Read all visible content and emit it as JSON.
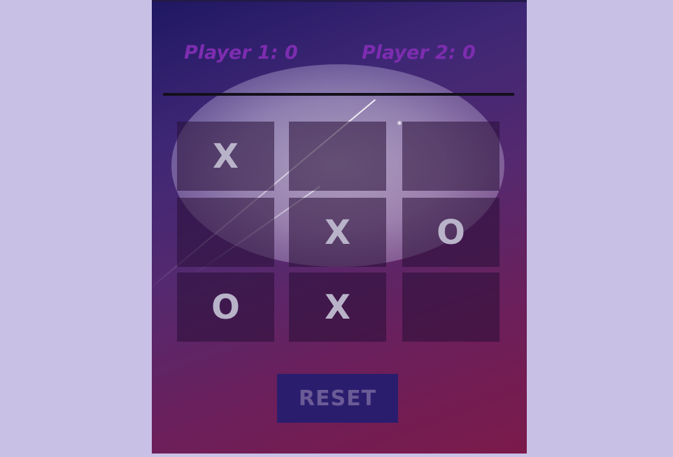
{
  "scoreboard": {
    "player1": "Player 1: 0",
    "player2": "Player 2: 0"
  },
  "board": {
    "cells": [
      "X",
      "",
      "",
      "",
      "X",
      "O",
      "O",
      "X",
      ""
    ]
  },
  "reset_label": "RESET",
  "colors": {
    "page_background": "#c9c0e6",
    "score_text": "#7d2db0",
    "mark_text": "#b9b3c9",
    "reset_button": "#2b1d6e",
    "reset_text": "#6b5b96"
  }
}
